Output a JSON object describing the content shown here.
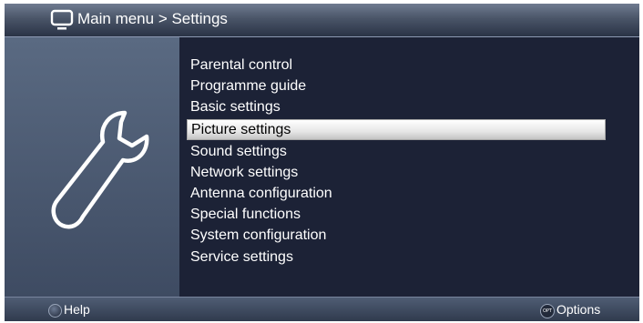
{
  "header": {
    "title": "Main menu > Settings",
    "icon": "tv-icon"
  },
  "sidebar": {
    "icon": "wrench-icon"
  },
  "menu": {
    "items": [
      {
        "label": "Parental control",
        "selected": false
      },
      {
        "label": "Programme guide",
        "selected": false
      },
      {
        "label": "Basic settings",
        "selected": false
      },
      {
        "label": "Picture settings",
        "selected": true
      },
      {
        "label": "Sound settings",
        "selected": false
      },
      {
        "label": "Network settings",
        "selected": false
      },
      {
        "label": "Antenna configuration",
        "selected": false
      },
      {
        "label": "Special functions",
        "selected": false
      },
      {
        "label": "System configuration",
        "selected": false
      },
      {
        "label": "Service settings",
        "selected": false
      }
    ]
  },
  "footer": {
    "help_label": "Help",
    "options_key_label": "OPT",
    "options_label": "Options"
  },
  "colors": {
    "background": "#1c2236",
    "panel": "#4b5870",
    "highlight": "#e6e6e6",
    "text": "#ffffff"
  }
}
